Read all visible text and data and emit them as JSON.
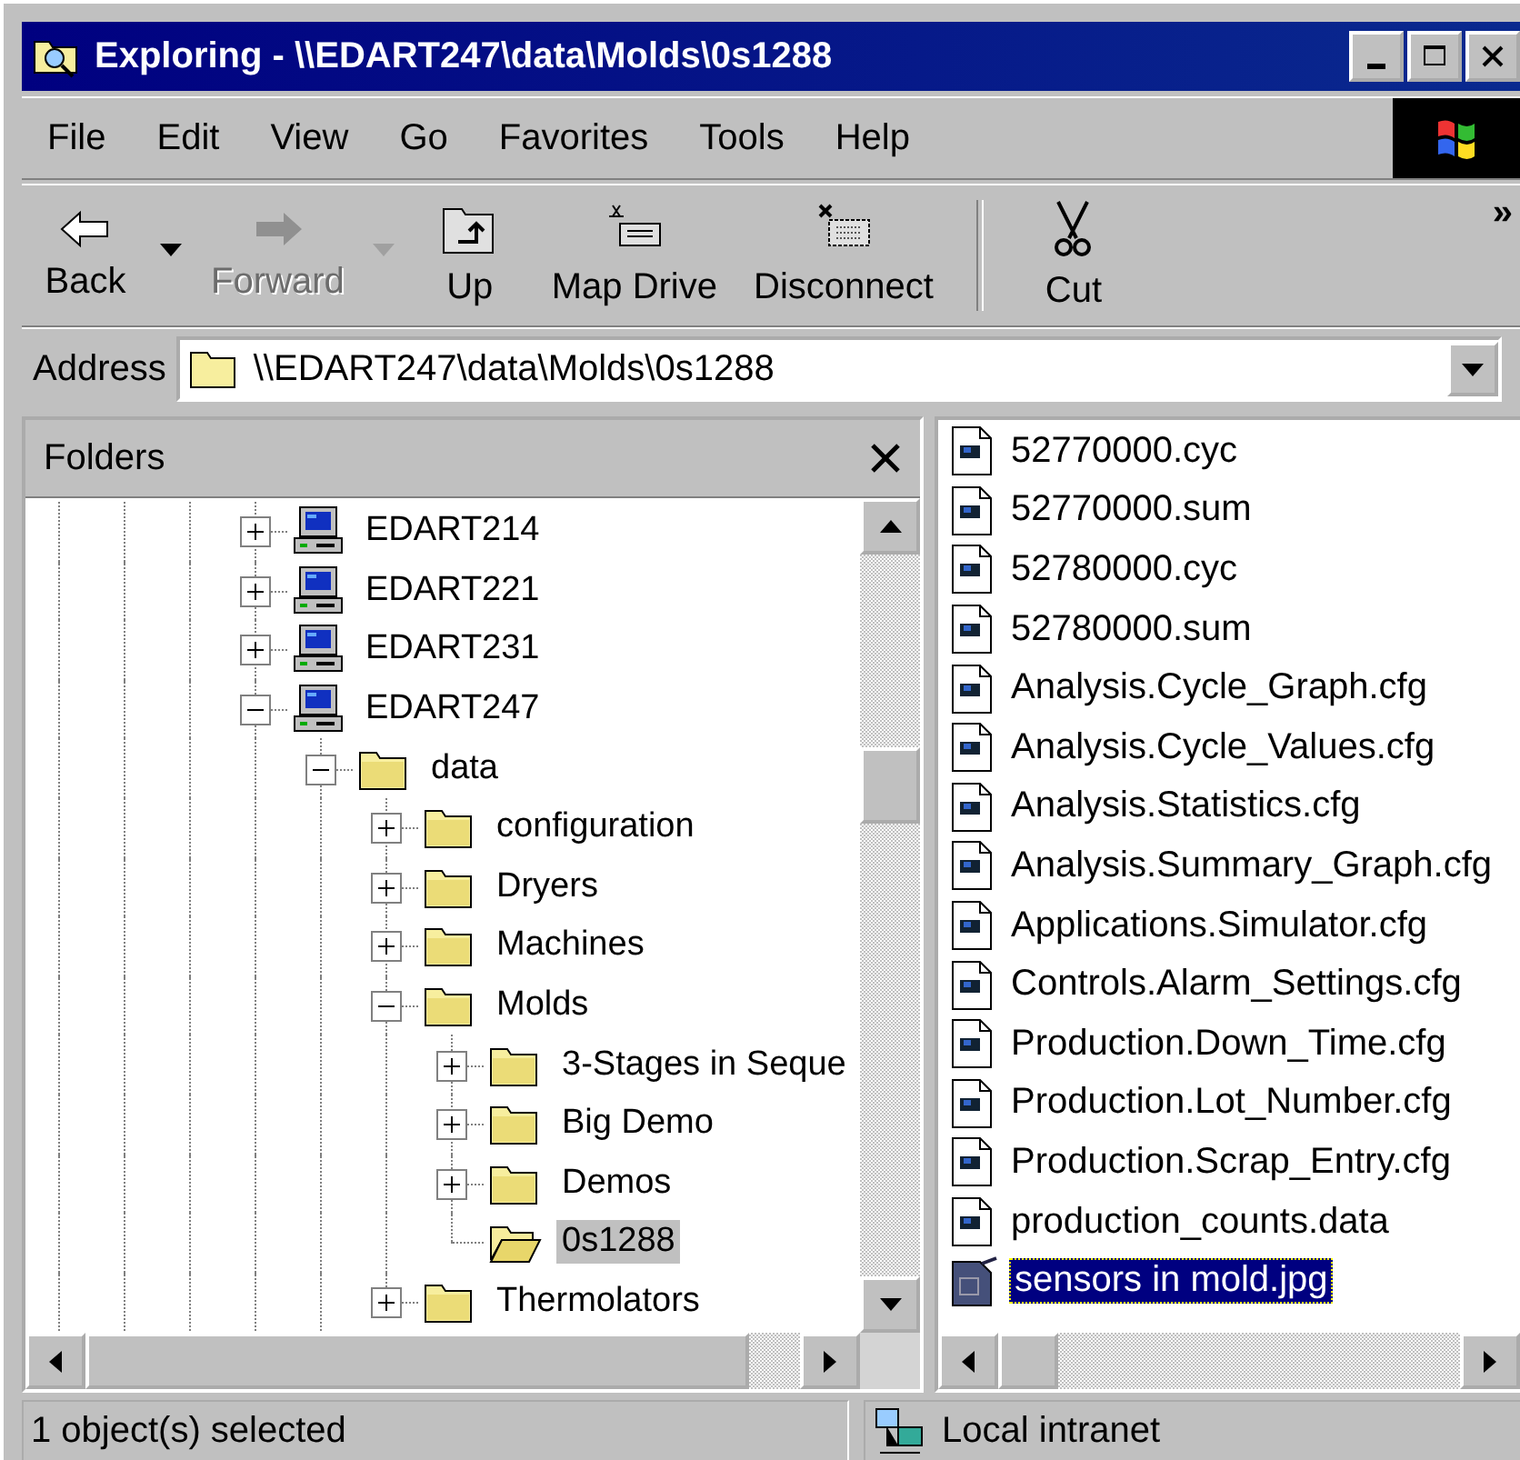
{
  "window": {
    "title": "Exploring - \\\\EDART247\\data\\Molds\\0s1288"
  },
  "menu": [
    "File",
    "Edit",
    "View",
    "Go",
    "Favorites",
    "Tools",
    "Help"
  ],
  "toolbar": {
    "buttons": [
      {
        "label": "Back",
        "kind": "back",
        "disabled": false,
        "dropdown": true
      },
      {
        "label": "Forward",
        "kind": "forward",
        "disabled": true,
        "dropdown": true
      },
      {
        "label": "Up",
        "kind": "up",
        "disabled": false,
        "dropdown": false
      },
      {
        "label": "Map Drive",
        "kind": "map-drive",
        "disabled": false,
        "dropdown": false
      },
      {
        "label": "Disconnect",
        "kind": "disconnect",
        "disabled": false,
        "dropdown": false
      },
      {
        "kind": "separator"
      },
      {
        "label": "Cut",
        "kind": "cut",
        "disabled": false,
        "dropdown": false
      }
    ],
    "overflow": "»"
  },
  "address": {
    "label": "Address",
    "value": "\\\\EDART247\\data\\Molds\\0s1288"
  },
  "folders": {
    "title": "Folders",
    "tree": [
      {
        "label": "EDART214",
        "kind": "computer",
        "expanded": false,
        "selected": false
      },
      {
        "label": "EDART221",
        "kind": "computer",
        "expanded": false,
        "selected": false
      },
      {
        "label": "EDART231",
        "kind": "computer",
        "expanded": false,
        "selected": false
      },
      {
        "label": "EDART247",
        "kind": "computer",
        "expanded": true,
        "selected": false,
        "children": [
          {
            "label": "data",
            "kind": "folder",
            "expanded": true,
            "selected": false,
            "children": [
              {
                "label": "configuration",
                "kind": "folder",
                "expanded": false,
                "selected": false
              },
              {
                "label": "Dryers",
                "kind": "folder",
                "expanded": false,
                "selected": false
              },
              {
                "label": "Machines",
                "kind": "folder",
                "expanded": false,
                "selected": false
              },
              {
                "label": "Molds",
                "kind": "folder",
                "expanded": true,
                "selected": false,
                "children": [
                  {
                    "label": "3-Stages in Seque",
                    "kind": "folder",
                    "expanded": false,
                    "selected": false
                  },
                  {
                    "label": "Big Demo",
                    "kind": "folder",
                    "expanded": false,
                    "selected": false
                  },
                  {
                    "label": "Demos",
                    "kind": "folder",
                    "expanded": false,
                    "selected": false
                  },
                  {
                    "label": "0s1288",
                    "kind": "folder",
                    "selected": true
                  }
                ]
              },
              {
                "label": "Thermolators",
                "kind": "folder",
                "expanded": false,
                "selected": false
              }
            ]
          }
        ]
      }
    ]
  },
  "files": [
    {
      "name": "52770000.cyc",
      "kind": "data",
      "selected": false
    },
    {
      "name": "52770000.sum",
      "kind": "data",
      "selected": false
    },
    {
      "name": "52780000.cyc",
      "kind": "data",
      "selected": false
    },
    {
      "name": "52780000.sum",
      "kind": "data",
      "selected": false
    },
    {
      "name": "Analysis.Cycle_Graph.cfg",
      "kind": "data",
      "selected": false
    },
    {
      "name": "Analysis.Cycle_Values.cfg",
      "kind": "data",
      "selected": false
    },
    {
      "name": "Analysis.Statistics.cfg",
      "kind": "data",
      "selected": false
    },
    {
      "name": "Analysis.Summary_Graph.cfg",
      "kind": "data",
      "selected": false
    },
    {
      "name": "Applications.Simulator.cfg",
      "kind": "data",
      "selected": false
    },
    {
      "name": "Controls.Alarm_Settings.cfg",
      "kind": "data",
      "selected": false
    },
    {
      "name": "Production.Down_Time.cfg",
      "kind": "data",
      "selected": false
    },
    {
      "name": "Production.Lot_Number.cfg",
      "kind": "data",
      "selected": false
    },
    {
      "name": "Production.Scrap_Entry.cfg",
      "kind": "data",
      "selected": false
    },
    {
      "name": "production_counts.data",
      "kind": "data",
      "selected": false
    },
    {
      "name": "sensors in mold.jpg",
      "kind": "image",
      "selected": true
    }
  ],
  "status_bar": {
    "message": "1 object(s) selected",
    "zone": "Local intranet"
  }
}
